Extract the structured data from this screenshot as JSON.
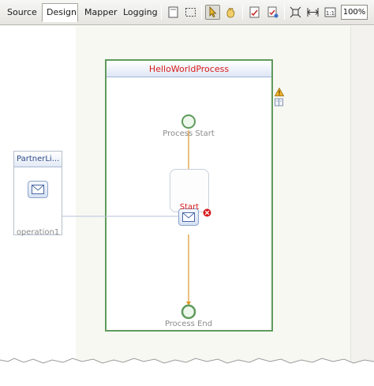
{
  "tabs": [
    {
      "label": "Source",
      "active": false
    },
    {
      "label": "Design",
      "active": true
    },
    {
      "label": "Mapper",
      "active": false
    },
    {
      "label": "Logging",
      "active": false
    }
  ],
  "toolbar": {
    "tools": [
      {
        "icon": "show-partner-links-icon",
        "pressed": false
      },
      {
        "icon": "marquee-select-icon",
        "pressed": false
      },
      {
        "icon": "select-pointer-icon",
        "pressed": true
      },
      {
        "icon": "hand-pan-icon",
        "pressed": false
      },
      {
        "icon": "validate-icon",
        "pressed": false
      },
      {
        "icon": "advanced-validate-icon",
        "pressed": false
      },
      {
        "icon": "fit-diagram-icon",
        "pressed": false
      },
      {
        "icon": "fit-width-icon",
        "pressed": false
      },
      {
        "icon": "actual-size-icon",
        "pressed": false
      }
    ],
    "zoom": "100%"
  },
  "palette": [
    {
      "icon": "add-partner-link-icon"
    },
    {
      "icon": "add-variable-icon"
    },
    {
      "icon": "add-correlation-set-icon"
    },
    {
      "icon": "add-message-exchange-icon"
    }
  ],
  "process": {
    "name": "HelloWorldProcess",
    "start_label": "Process Start",
    "end_label": "Process End",
    "receive_label": "Start",
    "status_icons": [
      "warning-icon",
      "documentation-icon"
    ]
  },
  "partner_link": {
    "name": "PartnerLi...",
    "operation": "operation1"
  },
  "colors": {
    "process_border": "#5f9b5c",
    "process_title": "#d81c1c",
    "flow_line": "#e0962a",
    "start_node": "#5f9b5c",
    "error_badge": "#d81c1c"
  }
}
